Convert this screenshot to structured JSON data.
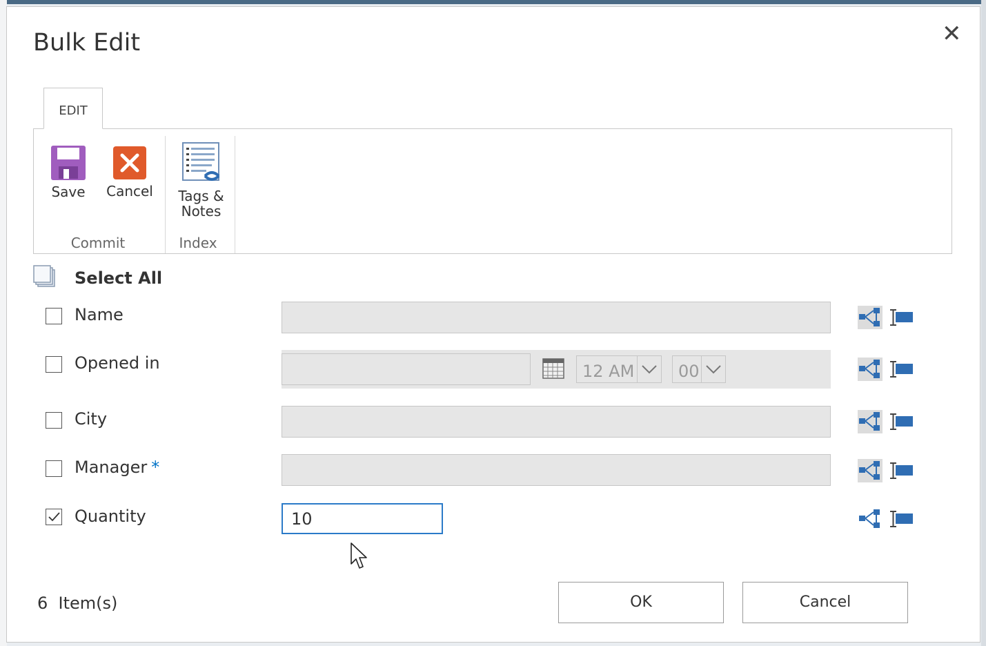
{
  "dialog": {
    "title": "Bulk Edit",
    "close_symbol": "✕"
  },
  "ribbon": {
    "tab_label": "EDIT",
    "buttons": {
      "save": "Save",
      "cancel": "Cancel",
      "tags_line1": "Tags &",
      "tags_line2": "Notes"
    },
    "groups": {
      "commit": "Commit",
      "index": "Index"
    },
    "icons": {
      "save": "save-floppy-icon",
      "cancel": "cancel-x-icon",
      "tags": "tags-notes-icon"
    },
    "colors": {
      "save": "#a05dbe",
      "cancel": "#e05a2b"
    }
  },
  "form": {
    "select_all_label": "Select All",
    "rows": [
      {
        "label": "Name",
        "checked": false,
        "required": false
      },
      {
        "label": "Opened in",
        "checked": false,
        "required": false
      },
      {
        "label": "City",
        "checked": false,
        "required": false
      },
      {
        "label": "Manager",
        "checked": false,
        "required": true
      },
      {
        "label": "Quantity",
        "checked": true,
        "required": false
      }
    ],
    "required_marker": "*",
    "opened_in": {
      "hour": "12 AM",
      "minute": "00"
    },
    "quantity_value": "10",
    "row_icons": [
      "workflow-icon",
      "column-settings-icon"
    ]
  },
  "footer": {
    "item_count": "6",
    "item_label": "Item(s)",
    "ok_label": "OK",
    "cancel_label": "Cancel"
  },
  "accent_color": "#2a7ac8"
}
